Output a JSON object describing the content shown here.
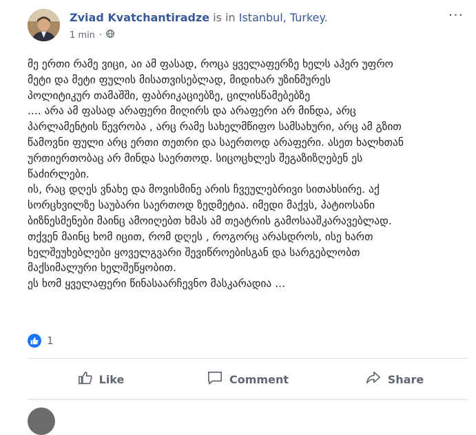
{
  "post": {
    "author": "Zviad Kvatchantiradze",
    "checkin_text": " is in ",
    "location": "Istanbul, Turkey",
    "location_suffix": ".",
    "time": "1 min",
    "time_separator": "·",
    "privacy_icon": "globe-icon",
    "more_label": "···",
    "lines": [
      "მე ერთი რამე ვიცი, აი ამ ფასად, როცა ყველაფერზე ხელს აჰერ უფრო",
      "მეტი და მეტი ფულის მისათვისებლად, მიდიხარ უზინმურეს",
      "პოლიტიკურ თამაშში, ფაბრიკაციებზე, ცილისწამებებზე",
      ".... არა ამ ფასად არაფერი მიღირს და არაფერი არ მინდა, არც",
      "პარლამენტის წევრობა , არც რამე სახელმწიფო სამსახური, არც ამ გზით",
      "წამოვნი ფული არც ერთი თეთრი და საერთოდ არაფერი. ასეთ ხალხთან",
      "ურთიერთობაც არ მინდა საერთოდ. სიცოცხლეს შეგაზიზღებენ ეს",
      "წაძირლები.",
      "ის, რაც დღეს ვნახე და მოვისმინე არის ჩვეულებრივი სითახსირე. აქ",
      "სორცხვილზე საუბარი საერთოდ ზედმეტია. იმედი მაქვს, პატიოსანი",
      "ბიზნესმენები მაინც ამოიღებთ ხმას ამ თეატრის გამოსააშკარავებლად.",
      "თქვენ მაინც ხომ იცით, რომ დღეს , როგორც არასდროს, ისე ხართ",
      "ხელშეუხებლები ყოველგვარი შევიწროებისგან და სარგებლობთ",
      "მაქსიმალური ხელშეწყობით.",
      "ეს ხომ ყველაფერი წინასაარჩევნო მასკარადია ..."
    ]
  },
  "reactions": {
    "icon": "like-reaction-icon",
    "count": "1"
  },
  "actions": {
    "like": {
      "label": "Like",
      "icon": "thumbs-up-icon"
    },
    "comment": {
      "label": "Comment",
      "icon": "comment-bubble-icon"
    },
    "share": {
      "label": "Share",
      "icon": "share-arrow-icon"
    }
  },
  "colors": {
    "link": "#385898",
    "brand": "#1877f2",
    "muted": "#606770"
  }
}
